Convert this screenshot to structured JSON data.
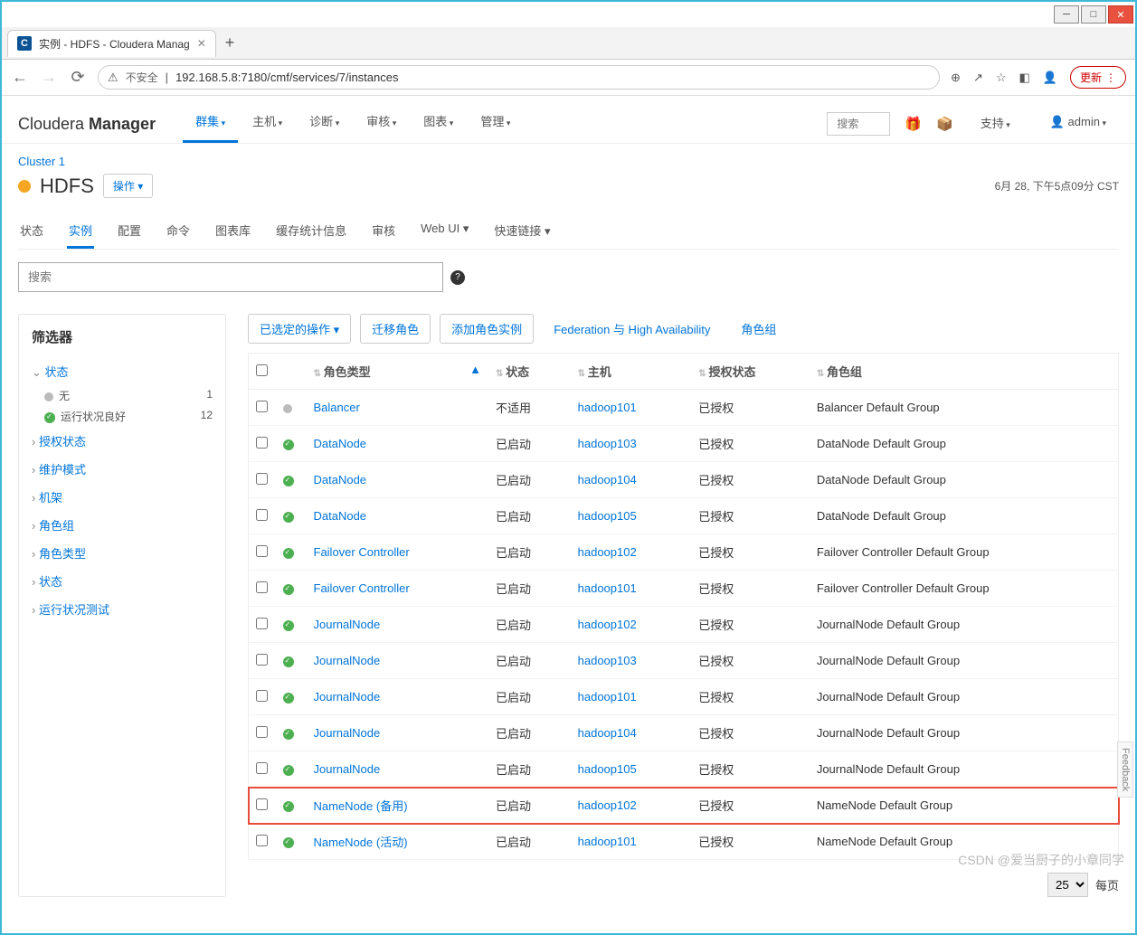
{
  "browser": {
    "tab_title": "实例 - HDFS - Cloudera Manag",
    "insecure_label": "不安全",
    "url": "192.168.5.8:7180/cmf/services/7/instances",
    "update_label": "更新"
  },
  "header": {
    "logo_light": "Cloudera ",
    "logo_bold": "Manager",
    "nav": [
      "群集",
      "主机",
      "诊断",
      "审核",
      "图表",
      "管理"
    ],
    "search_placeholder": "搜索",
    "support": "支持",
    "admin": "admin"
  },
  "service": {
    "cluster": "Cluster 1",
    "name": "HDFS",
    "ops": "操作",
    "timestamp": "6月 28, 下午5点09分 CST",
    "tabs": [
      "状态",
      "实例",
      "配置",
      "命令",
      "图表库",
      "缓存统计信息",
      "审核",
      "Web UI",
      "快速链接"
    ],
    "search_placeholder": "搜索"
  },
  "filter": {
    "title": "筛选器",
    "status": "状态",
    "none": "无",
    "none_count": "1",
    "good": "运行状况良好",
    "good_count": "12",
    "groups": [
      "授权状态",
      "维护模式",
      "机架",
      "角色组",
      "角色类型",
      "状态",
      "运行状况测试"
    ]
  },
  "actions": {
    "selected": "已选定的操作",
    "migrate": "迁移角色",
    "add": "添加角色实例",
    "federation": "Federation 与 High Availability",
    "rolegroup": "角色组"
  },
  "table": {
    "headers": {
      "roletype": "角色类型",
      "status": "状态",
      "host": "主机",
      "auth": "授权状态",
      "rolegroup": "角色组"
    },
    "rows": [
      {
        "icon": "grey",
        "role": "Balancer",
        "status": "不适用",
        "host": "hadoop101",
        "auth": "已授权",
        "group": "Balancer Default Group"
      },
      {
        "icon": "green",
        "role": "DataNode",
        "status": "已启动",
        "host": "hadoop103",
        "auth": "已授权",
        "group": "DataNode Default Group"
      },
      {
        "icon": "green",
        "role": "DataNode",
        "status": "已启动",
        "host": "hadoop104",
        "auth": "已授权",
        "group": "DataNode Default Group"
      },
      {
        "icon": "green",
        "role": "DataNode",
        "status": "已启动",
        "host": "hadoop105",
        "auth": "已授权",
        "group": "DataNode Default Group"
      },
      {
        "icon": "green",
        "role": "Failover Controller",
        "status": "已启动",
        "host": "hadoop102",
        "auth": "已授权",
        "group": "Failover Controller Default Group"
      },
      {
        "icon": "green",
        "role": "Failover Controller",
        "status": "已启动",
        "host": "hadoop101",
        "auth": "已授权",
        "group": "Failover Controller Default Group"
      },
      {
        "icon": "green",
        "role": "JournalNode",
        "status": "已启动",
        "host": "hadoop102",
        "auth": "已授权",
        "group": "JournalNode Default Group"
      },
      {
        "icon": "green",
        "role": "JournalNode",
        "status": "已启动",
        "host": "hadoop103",
        "auth": "已授权",
        "group": "JournalNode Default Group"
      },
      {
        "icon": "green",
        "role": "JournalNode",
        "status": "已启动",
        "host": "hadoop101",
        "auth": "已授权",
        "group": "JournalNode Default Group"
      },
      {
        "icon": "green",
        "role": "JournalNode",
        "status": "已启动",
        "host": "hadoop104",
        "auth": "已授权",
        "group": "JournalNode Default Group"
      },
      {
        "icon": "green",
        "role": "JournalNode",
        "status": "已启动",
        "host": "hadoop105",
        "auth": "已授权",
        "group": "JournalNode Default Group"
      },
      {
        "icon": "green",
        "role": "NameNode (备用)",
        "status": "已启动",
        "host": "hadoop102",
        "auth": "已授权",
        "group": "NameNode Default Group",
        "highlight": true
      },
      {
        "icon": "green",
        "role": "NameNode (活动)",
        "status": "已启动",
        "host": "hadoop101",
        "auth": "已授权",
        "group": "NameNode Default Group"
      }
    ]
  },
  "pager": {
    "size": "25",
    "label": "每页"
  },
  "feedback": "Feedback",
  "watermark": "CSDN @爱当厨子的小章同学"
}
